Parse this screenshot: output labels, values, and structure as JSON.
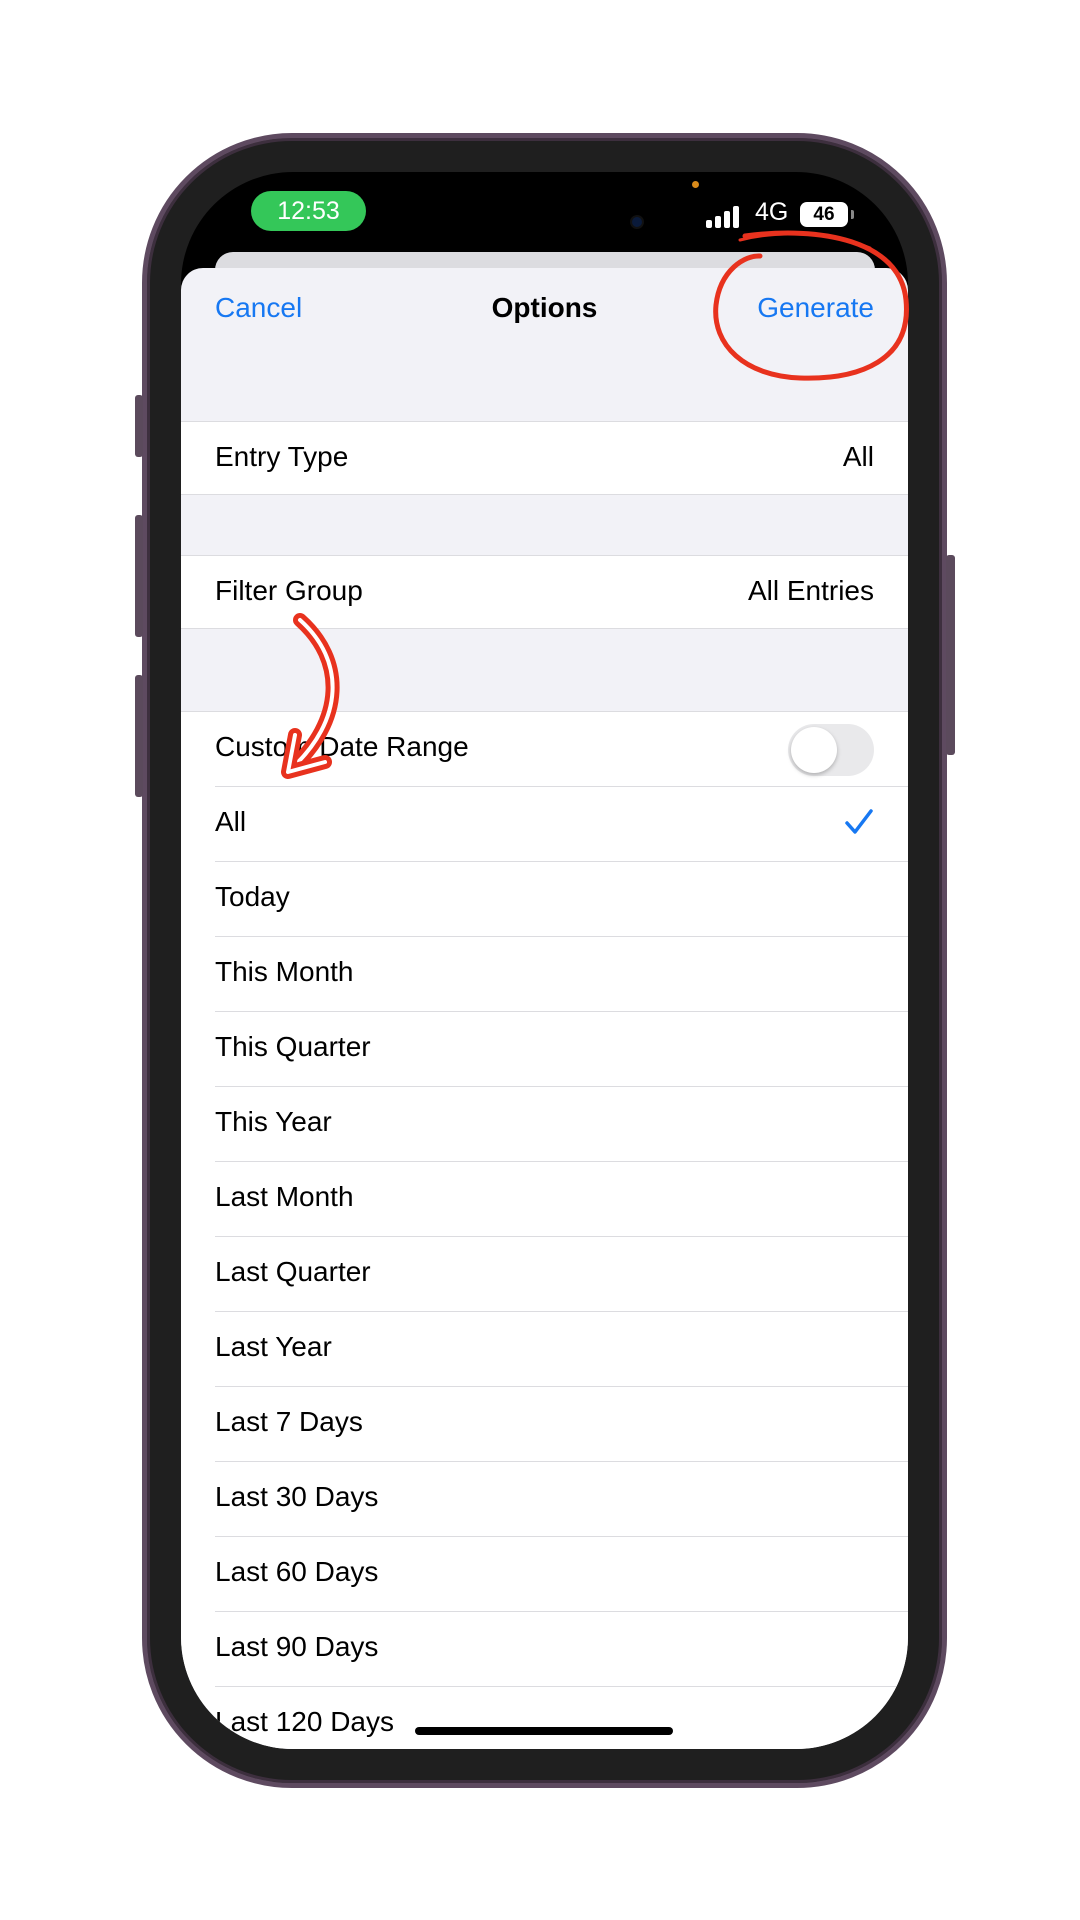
{
  "status_bar": {
    "time": "12:53",
    "network": "4G",
    "battery": "46",
    "time_pill_color": "#34c759"
  },
  "nav": {
    "cancel_label": "Cancel",
    "title": "Options",
    "generate_label": "Generate",
    "accent_color": "#1778f2"
  },
  "settings": {
    "entry_type": {
      "label": "Entry Type",
      "value": "All"
    },
    "filter_group": {
      "label": "Filter Group",
      "value": "All Entries"
    },
    "custom_date_range": {
      "label": "Custom Date Range",
      "enabled": false
    }
  },
  "date_ranges": [
    {
      "label": "All",
      "selected": true
    },
    {
      "label": "Today",
      "selected": false
    },
    {
      "label": "This Month",
      "selected": false
    },
    {
      "label": "This Quarter",
      "selected": false
    },
    {
      "label": "This Year",
      "selected": false
    },
    {
      "label": "Last Month",
      "selected": false
    },
    {
      "label": "Last Quarter",
      "selected": false
    },
    {
      "label": "Last Year",
      "selected": false
    },
    {
      "label": "Last 7 Days",
      "selected": false
    },
    {
      "label": "Last 30 Days",
      "selected": false
    },
    {
      "label": "Last 60 Days",
      "selected": false
    },
    {
      "label": "Last 90 Days",
      "selected": false
    },
    {
      "label": "Last 120 Days",
      "selected": false
    }
  ],
  "annotations": {
    "circle_target": "generate-button",
    "arrow_target": "custom-date-range-row",
    "annotation_color": "#e8321e"
  }
}
